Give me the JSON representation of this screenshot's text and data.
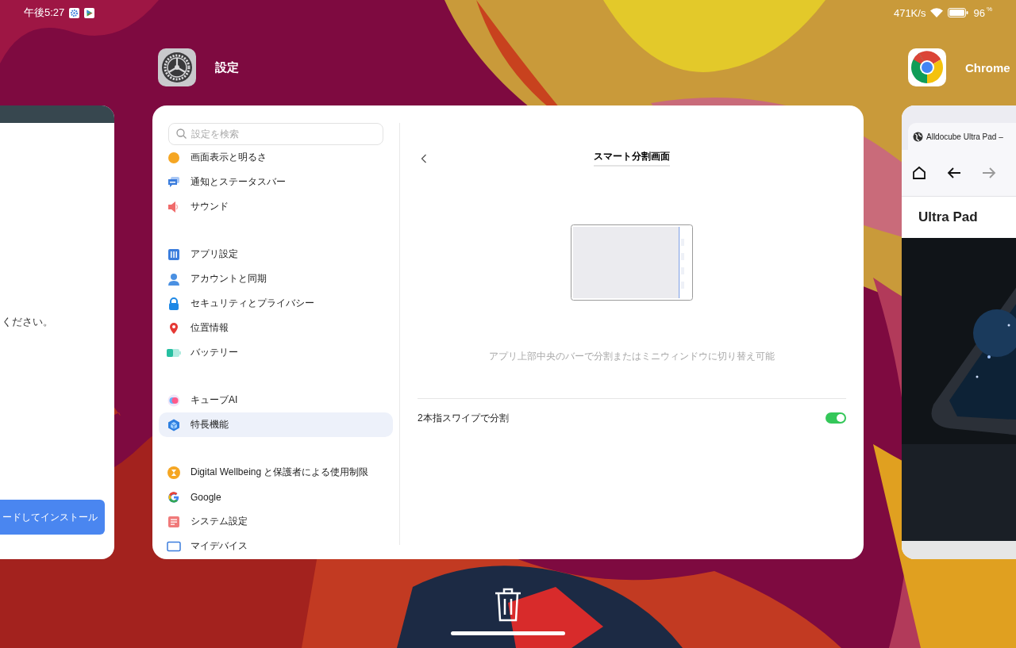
{
  "status_bar": {
    "time": "午後5:27",
    "network_speed": "471K/s",
    "battery": "96",
    "battery_unit": "%"
  },
  "left_card": {
    "message": "ください。",
    "button": "ードしてインストール"
  },
  "settings_app": {
    "label": "設定",
    "search": {
      "placeholder": "設定を検索"
    },
    "groups": [
      [
        {
          "label": "画面表示と明るさ",
          "selected": false
        },
        {
          "label": "通知とステータスバー",
          "selected": false
        },
        {
          "label": "サウンド",
          "selected": false
        }
      ],
      [
        {
          "label": "アプリ設定",
          "selected": false
        },
        {
          "label": "アカウントと同期",
          "selected": false
        },
        {
          "label": "セキュリティとプライバシー",
          "selected": false
        },
        {
          "label": "位置情報",
          "selected": false
        },
        {
          "label": "バッテリー",
          "selected": false
        }
      ],
      [
        {
          "label": "キューブAI",
          "selected": false
        },
        {
          "label": "特長機能",
          "selected": true
        }
      ],
      [
        {
          "label": "Digital Wellbeing と保護者による使用制限",
          "selected": false
        },
        {
          "label": "Google",
          "selected": false
        },
        {
          "label": "システム設定",
          "selected": false
        },
        {
          "label": "マイデバイス",
          "selected": false
        }
      ]
    ],
    "detail": {
      "title": "スマート分割画面",
      "description": "アプリ上部中央のバーで分割またはミニウィンドウに切り替え可能",
      "toggle": {
        "label": "2本指スワイプで分割",
        "on": true
      }
    }
  },
  "chrome_app": {
    "label": "Chrome",
    "tab_title": "Alldocube Ultra Pad –",
    "page_heading": "Ultra Pad"
  }
}
